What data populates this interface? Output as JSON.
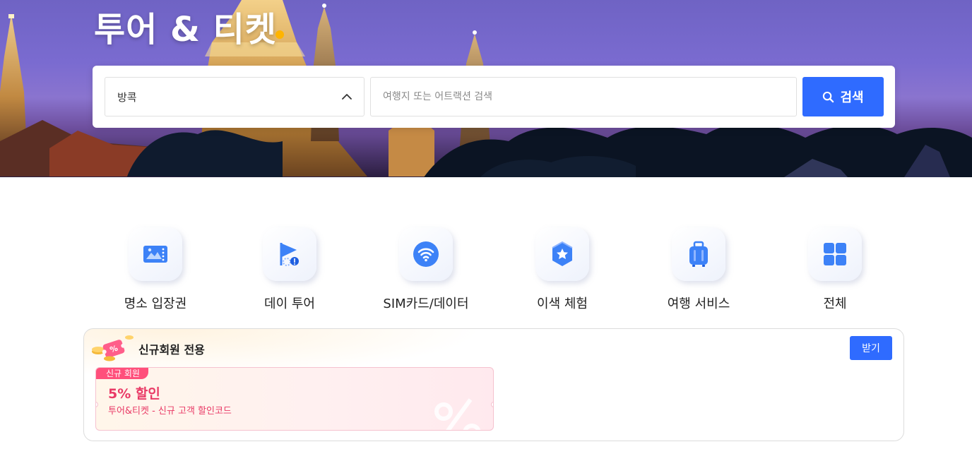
{
  "hero": {
    "title": "투어 & 티켓"
  },
  "search": {
    "city_value": "방콕",
    "input_placeholder": "여행지 또는 어트랙션 검색",
    "button_label": "검색"
  },
  "categories": [
    {
      "label": "명소 입장권",
      "icon": "ticket-icon"
    },
    {
      "label": "데이 투어",
      "icon": "flag-icon"
    },
    {
      "label": "SIM카드/데이터",
      "icon": "wifi-icon"
    },
    {
      "label": "이색 체험",
      "icon": "star-badge-icon"
    },
    {
      "label": "여행 서비스",
      "icon": "luggage-icon"
    },
    {
      "label": "전체",
      "icon": "grid-icon"
    }
  ],
  "promo": {
    "title": "신규회원 전용",
    "receive_label": "받기",
    "coupon": {
      "badge": "신규 회원",
      "amount": "5% 할인",
      "description": "투어&티켓 - 신규 고객 할인코드"
    }
  },
  "colors": {
    "accent": "#2f6bff",
    "title_dot": "#ffb400",
    "coupon_text": "#e93a66",
    "coupon_badge": "#ff4f7b"
  }
}
